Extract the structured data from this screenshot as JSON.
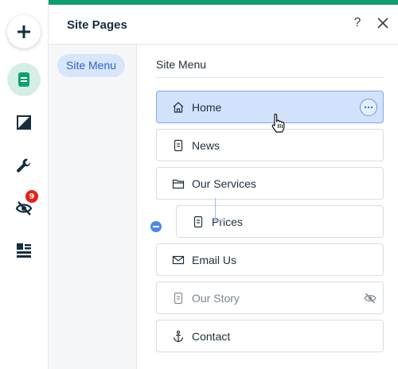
{
  "toolbar": {
    "badge_count": "9",
    "tools": [
      {
        "icon": "plus-icon"
      },
      {
        "icon": "pages-icon"
      },
      {
        "icon": "design-icon"
      },
      {
        "icon": "wrench-icon"
      },
      {
        "icon": "hidden-eye-icon"
      },
      {
        "icon": "layout-icon"
      }
    ]
  },
  "panel": {
    "title": "Site Pages",
    "help_label": "?",
    "left_tab": "Site Menu",
    "menu_heading": "Site Menu"
  },
  "pages": [
    {
      "label": "Home",
      "icon": "home-icon",
      "selected": true
    },
    {
      "label": "News",
      "icon": "page-icon"
    },
    {
      "label": "Our Services",
      "icon": "folder-icon"
    },
    {
      "label": "Prices",
      "icon": "page-icon",
      "subpage": true
    },
    {
      "label": "Email Us",
      "icon": "mail-icon"
    },
    {
      "label": "Our Story",
      "icon": "page-icon",
      "hidden": true
    },
    {
      "label": "Contact",
      "icon": "anchor-icon"
    }
  ],
  "colors": {
    "accent_green": "#0f9e6f",
    "selected_bg": "#d3e2fc",
    "selected_border": "#7fa8ef",
    "tab_bg": "#d8e6fb",
    "badge_red": "#e62214"
  }
}
